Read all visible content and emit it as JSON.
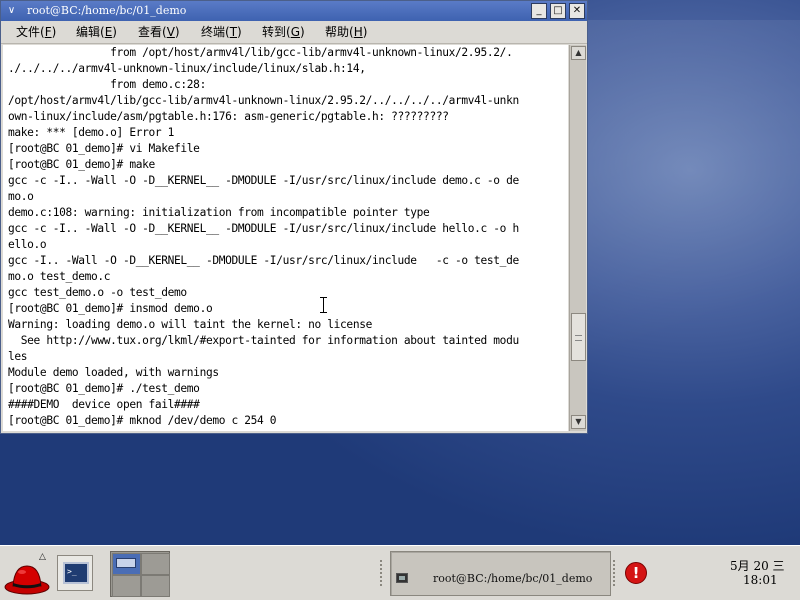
{
  "window": {
    "title": "root@BC:/home/bc/01_demo",
    "menu_glyph": "∨",
    "min_glyph": "_",
    "max_glyph": "□",
    "close_glyph": "✕"
  },
  "menubar": [
    {
      "label": "文件(",
      "key": "F",
      "end": ")"
    },
    {
      "label": "编辑(",
      "key": "E",
      "end": ")"
    },
    {
      "label": "查看(",
      "key": "V",
      "end": ")"
    },
    {
      "label": "终端(",
      "key": "T",
      "end": ")"
    },
    {
      "label": "转到(",
      "key": "G",
      "end": ")"
    },
    {
      "label": "帮助(",
      "key": "H",
      "end": ")"
    }
  ],
  "terminal": {
    "lines": [
      "                from /opt/host/armv4l/lib/gcc-lib/armv4l-unknown-linux/2.95.2/.",
      "./../../../armv4l-unknown-linux/include/linux/slab.h:14,",
      "                from demo.c:28:",
      "/opt/host/armv4l/lib/gcc-lib/armv4l-unknown-linux/2.95.2/../../../../armv4l-unkn",
      "own-linux/include/asm/pgtable.h:176: asm-generic/pgtable.h: ?????????",
      "make: *** [demo.o] Error 1",
      "[root@BC 01_demo]# vi Makefile",
      "[root@BC 01_demo]# make",
      "gcc -c -I.. -Wall -O -D__KERNEL__ -DMODULE -I/usr/src/linux/include demo.c -o de",
      "mo.o",
      "demo.c:108: warning: initialization from incompatible pointer type",
      "gcc -c -I.. -Wall -O -D__KERNEL__ -DMODULE -I/usr/src/linux/include hello.c -o h",
      "ello.o",
      "gcc -I.. -Wall -O -D__KERNEL__ -DMODULE -I/usr/src/linux/include   -c -o test_de",
      "mo.o test_demo.c",
      "gcc test_demo.o -o test_demo",
      "[root@BC 01_demo]# insmod demo.o",
      "Warning: loading demo.o will taint the kernel: no license",
      "  See http://www.tux.org/lkml/#export-tainted for information about tainted modu",
      "les",
      "Module demo loaded, with warnings",
      "[root@BC 01_demo]# ./test_demo",
      "####DEMO  device open fail####",
      "[root@BC 01_demo]# mknod /dev/demo c 254 0"
    ]
  },
  "scrollbar": {
    "up_glyph": "▲",
    "down_glyph": "▼"
  },
  "panel": {
    "terminal_launcher_glyph": ">_",
    "launcher_arrow_glyph": "△",
    "task_label": "root@BC:/home/bc/01_demo",
    "alert_glyph": "!",
    "clock_date": "5月 20 三",
    "clock_time": "18:01"
  }
}
